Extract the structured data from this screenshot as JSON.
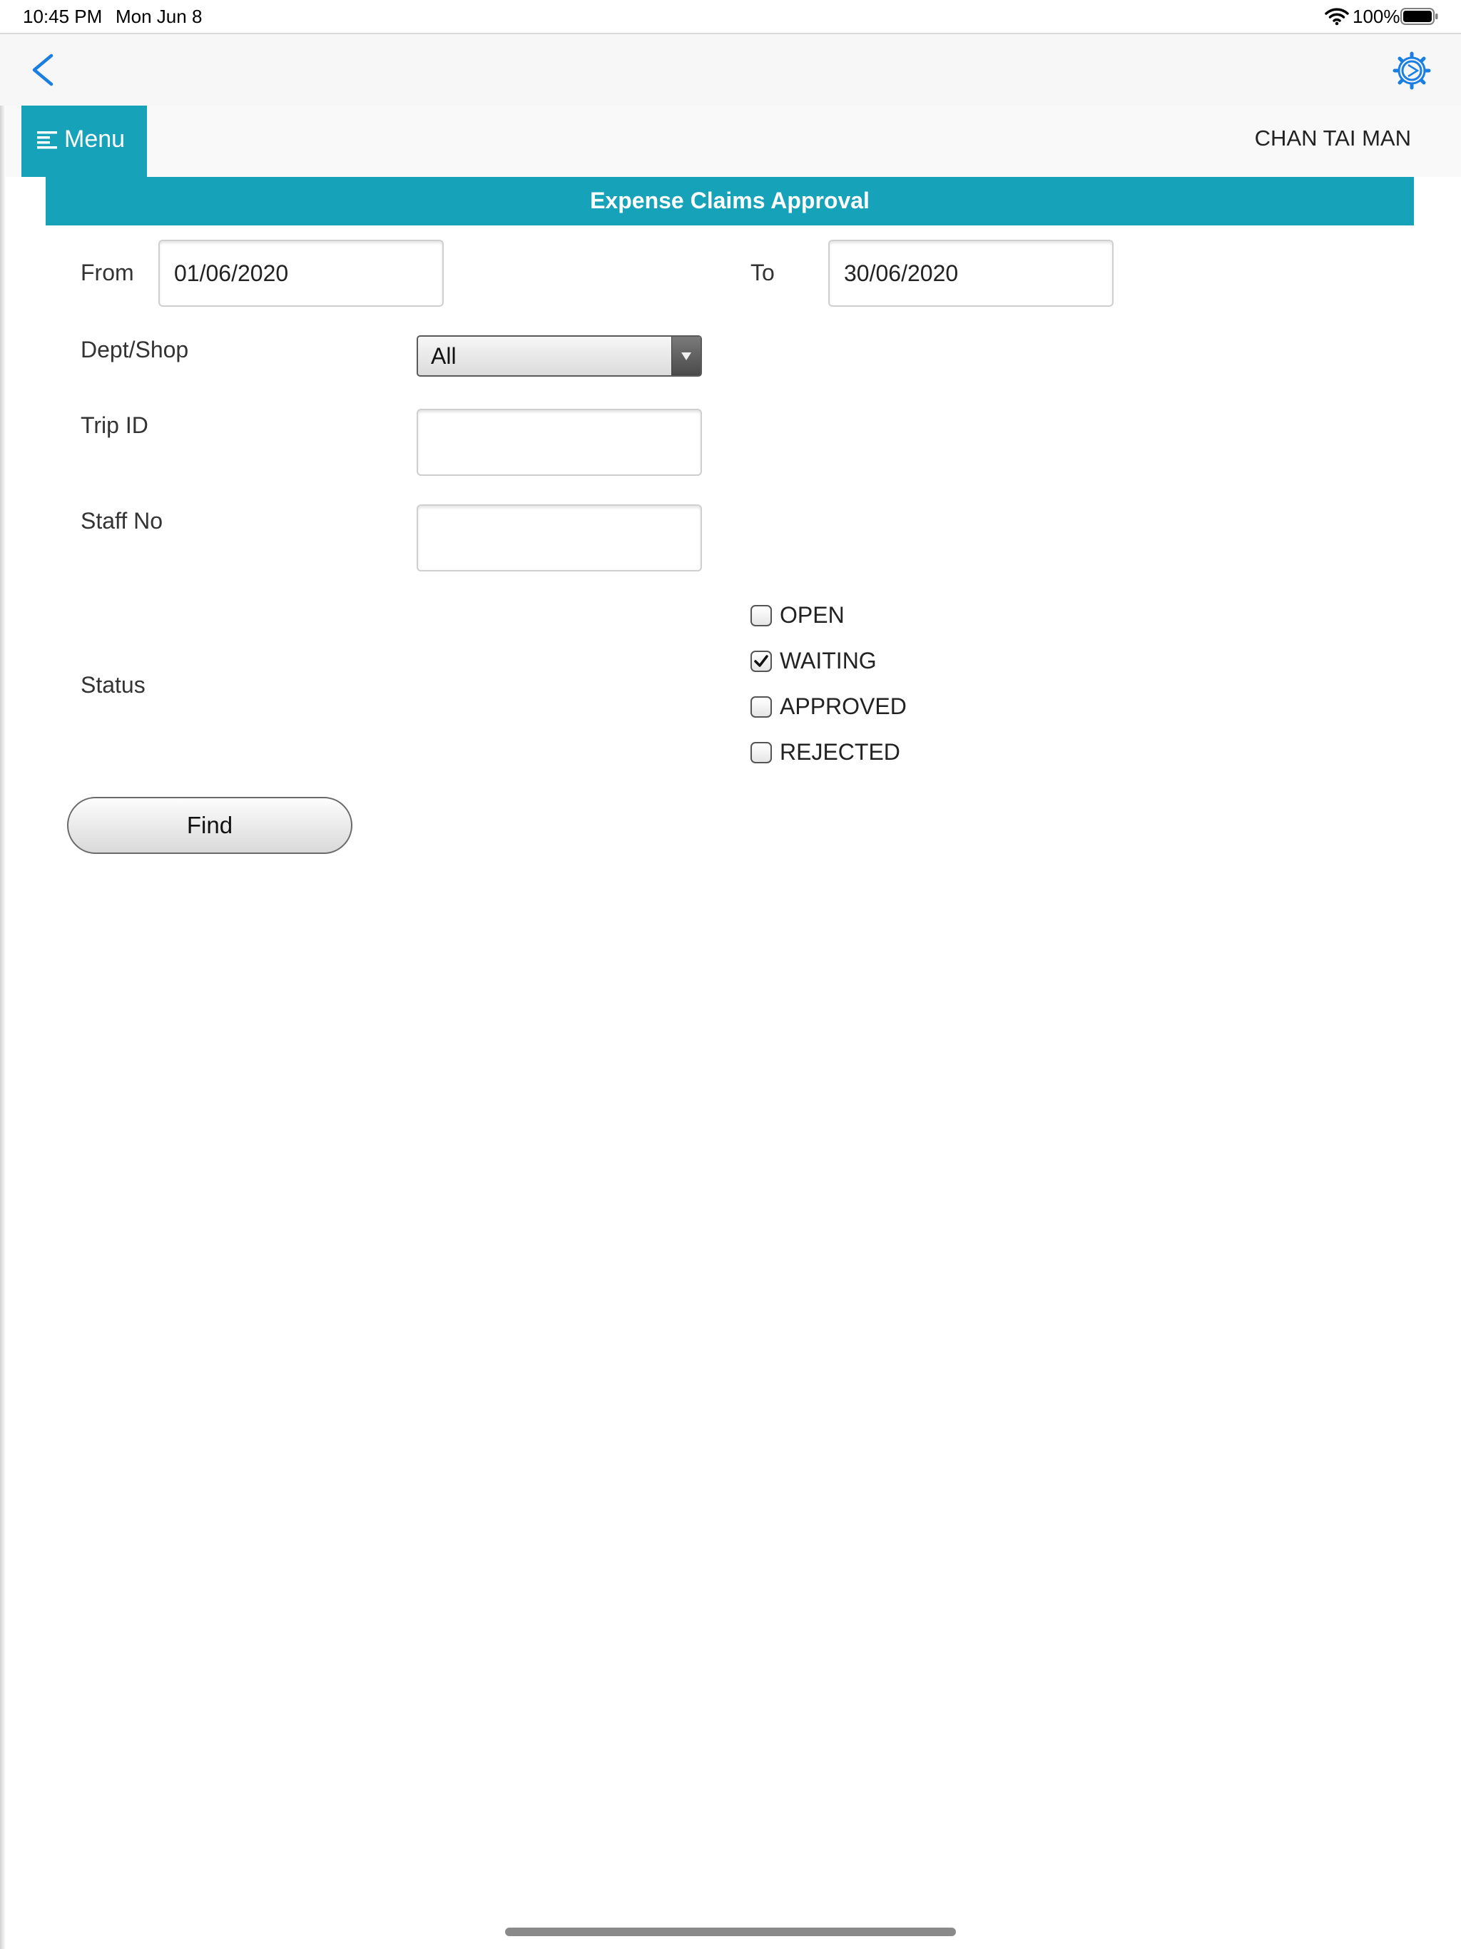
{
  "status_bar": {
    "time": "10:45 PM",
    "date": "Mon Jun 8",
    "battery": "100%",
    "icons": [
      "wifi-icon",
      "battery-icon"
    ]
  },
  "nav": {
    "back_icon": "chevron-left-icon",
    "settings_icon": "gear-icon",
    "accent_color": "#1a7fe0"
  },
  "header": {
    "menu_label": "Menu",
    "menu_icon": "hamburger-icon",
    "user_name": "CHAN TAI MAN",
    "brand_color": "#16a2b8"
  },
  "page": {
    "title": "Expense Claims Approval"
  },
  "form": {
    "from_label": "From",
    "from_value": "01/06/2020",
    "to_label": "To",
    "to_value": "30/06/2020",
    "dept_label": "Dept/Shop",
    "dept_value": "All",
    "trip_label": "Trip ID",
    "trip_value": "",
    "staff_label": "Staff No",
    "staff_value": "",
    "status_label": "Status",
    "status_options": [
      {
        "label": "OPEN",
        "checked": false
      },
      {
        "label": "WAITING",
        "checked": true
      },
      {
        "label": "APPROVED",
        "checked": false
      },
      {
        "label": "REJECTED",
        "checked": false
      }
    ],
    "find_label": "Find"
  }
}
